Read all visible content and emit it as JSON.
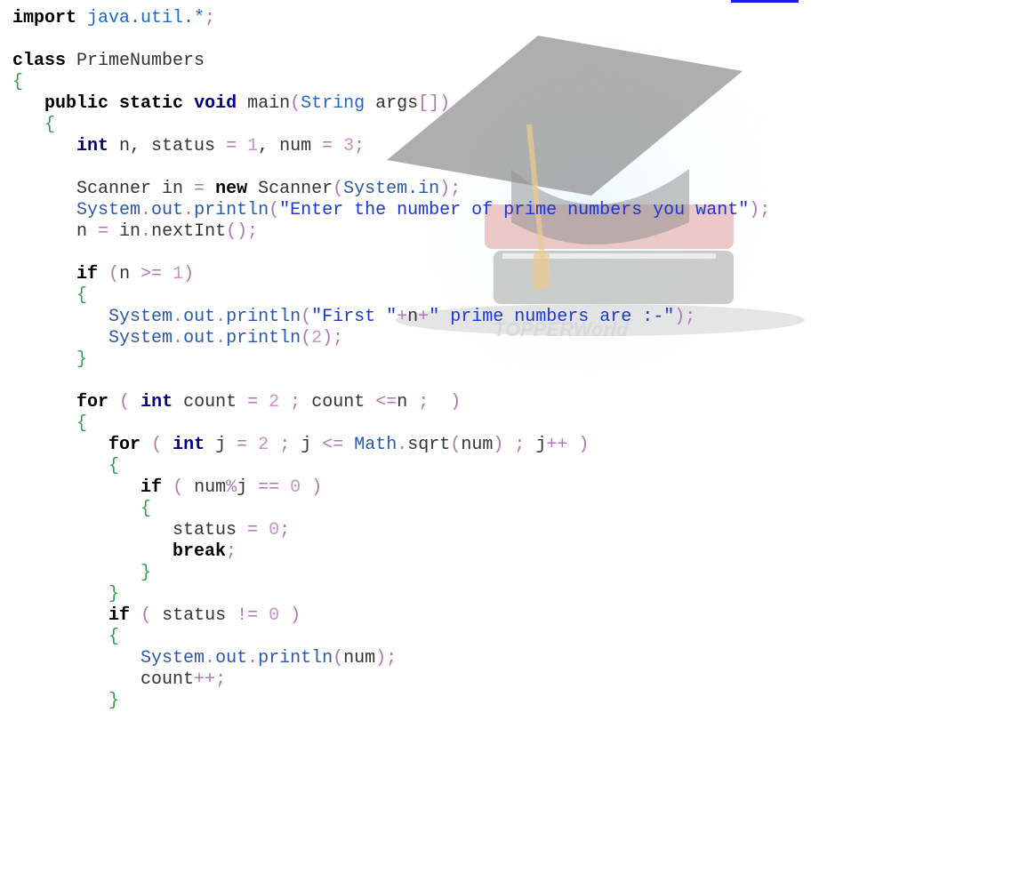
{
  "watermark": {
    "text": "TOPPERWorld"
  },
  "code": {
    "lines": [
      [
        {
          "t": "import",
          "c": "kb"
        },
        {
          "t": " java.util.*",
          "c": "pkg"
        },
        {
          "t": ";",
          "c": "sym"
        }
      ],
      [],
      [
        {
          "t": "class",
          "c": "kb"
        },
        {
          "t": " PrimeNumbers",
          "c": "plain"
        }
      ],
      [
        {
          "t": "{",
          "c": "brace"
        }
      ],
      [
        {
          "t": "   "
        },
        {
          "t": "public",
          "c": "kb"
        },
        {
          "t": " "
        },
        {
          "t": "static",
          "c": "kb"
        },
        {
          "t": " "
        },
        {
          "t": "void",
          "c": "kw"
        },
        {
          "t": " main",
          "c": "plain"
        },
        {
          "t": "(",
          "c": "sym"
        },
        {
          "t": "String",
          "c": "pkg"
        },
        {
          "t": " args",
          "c": "plain"
        },
        {
          "t": "[])",
          "c": "sym"
        }
      ],
      [
        {
          "t": "   "
        },
        {
          "t": "{",
          "c": "brace"
        }
      ],
      [
        {
          "t": "      "
        },
        {
          "t": "int",
          "c": "kw"
        },
        {
          "t": " n, status ",
          "c": "plain"
        },
        {
          "t": "=",
          "c": "sym"
        },
        {
          "t": " ",
          "c": "plain"
        },
        {
          "t": "1",
          "c": "num"
        },
        {
          "t": ", num ",
          "c": "plain"
        },
        {
          "t": "=",
          "c": "sym"
        },
        {
          "t": " ",
          "c": "plain"
        },
        {
          "t": "3",
          "c": "num"
        },
        {
          "t": ";",
          "c": "sym"
        }
      ],
      [],
      [
        {
          "t": "      Scanner in ",
          "c": "plain"
        },
        {
          "t": "=",
          "c": "sym"
        },
        {
          "t": " "
        },
        {
          "t": "new",
          "c": "kb"
        },
        {
          "t": " Scanner",
          "c": "plain"
        },
        {
          "t": "(",
          "c": "sym"
        },
        {
          "t": "System.in",
          "c": "sys"
        },
        {
          "t": ");",
          "c": "sym"
        }
      ],
      [
        {
          "t": "      "
        },
        {
          "t": "System",
          "c": "sys"
        },
        {
          "t": ".",
          "c": "sym"
        },
        {
          "t": "out",
          "c": "sys"
        },
        {
          "t": ".",
          "c": "sym"
        },
        {
          "t": "println",
          "c": "sys"
        },
        {
          "t": "(",
          "c": "sym"
        },
        {
          "t": "\"Enter the number of prime numbers you want\"",
          "c": "str"
        },
        {
          "t": ");",
          "c": "sym"
        }
      ],
      [
        {
          "t": "      n ",
          "c": "plain"
        },
        {
          "t": "=",
          "c": "sym"
        },
        {
          "t": " in",
          "c": "plain"
        },
        {
          "t": ".",
          "c": "sym"
        },
        {
          "t": "nextInt",
          "c": "plain"
        },
        {
          "t": "();",
          "c": "sym"
        }
      ],
      [],
      [
        {
          "t": "      "
        },
        {
          "t": "if",
          "c": "kb"
        },
        {
          "t": " ",
          "c": "plain"
        },
        {
          "t": "(",
          "c": "sym"
        },
        {
          "t": "n ",
          "c": "plain"
        },
        {
          "t": ">=",
          "c": "sym"
        },
        {
          "t": " ",
          "c": "plain"
        },
        {
          "t": "1",
          "c": "num"
        },
        {
          "t": ")",
          "c": "sym"
        }
      ],
      [
        {
          "t": "      "
        },
        {
          "t": "{",
          "c": "brace"
        }
      ],
      [
        {
          "t": "         "
        },
        {
          "t": "System",
          "c": "sys"
        },
        {
          "t": ".",
          "c": "sym"
        },
        {
          "t": "out",
          "c": "sys"
        },
        {
          "t": ".",
          "c": "sym"
        },
        {
          "t": "println",
          "c": "sys"
        },
        {
          "t": "(",
          "c": "sym"
        },
        {
          "t": "\"First \"",
          "c": "str"
        },
        {
          "t": "+",
          "c": "sym"
        },
        {
          "t": "n",
          "c": "plain"
        },
        {
          "t": "+",
          "c": "sym"
        },
        {
          "t": "\" prime numbers are :-\"",
          "c": "str"
        },
        {
          "t": ");",
          "c": "sym"
        }
      ],
      [
        {
          "t": "         "
        },
        {
          "t": "System",
          "c": "sys"
        },
        {
          "t": ".",
          "c": "sym"
        },
        {
          "t": "out",
          "c": "sys"
        },
        {
          "t": ".",
          "c": "sym"
        },
        {
          "t": "println",
          "c": "sys"
        },
        {
          "t": "(",
          "c": "sym"
        },
        {
          "t": "2",
          "c": "num"
        },
        {
          "t": ");",
          "c": "sym"
        }
      ],
      [
        {
          "t": "      "
        },
        {
          "t": "}",
          "c": "brace"
        }
      ],
      [],
      [
        {
          "t": "      "
        },
        {
          "t": "for",
          "c": "kb"
        },
        {
          "t": " ",
          "c": "plain"
        },
        {
          "t": "(",
          "c": "sym"
        },
        {
          "t": " "
        },
        {
          "t": "int",
          "c": "kw"
        },
        {
          "t": " count ",
          "c": "plain"
        },
        {
          "t": "=",
          "c": "sym"
        },
        {
          "t": " ",
          "c": "plain"
        },
        {
          "t": "2",
          "c": "num"
        },
        {
          "t": " ",
          "c": "plain"
        },
        {
          "t": ";",
          "c": "sym"
        },
        {
          "t": " count ",
          "c": "plain"
        },
        {
          "t": "<=",
          "c": "sym"
        },
        {
          "t": "n ",
          "c": "plain"
        },
        {
          "t": ";",
          "c": "sym"
        },
        {
          "t": "  ",
          "c": "plain"
        },
        {
          "t": ")",
          "c": "sym"
        }
      ],
      [
        {
          "t": "      "
        },
        {
          "t": "{",
          "c": "brace"
        }
      ],
      [
        {
          "t": "         "
        },
        {
          "t": "for",
          "c": "kb"
        },
        {
          "t": " ",
          "c": "plain"
        },
        {
          "t": "(",
          "c": "sym"
        },
        {
          "t": " "
        },
        {
          "t": "int",
          "c": "kw"
        },
        {
          "t": " j ",
          "c": "plain"
        },
        {
          "t": "=",
          "c": "sym"
        },
        {
          "t": " ",
          "c": "plain"
        },
        {
          "t": "2",
          "c": "num"
        },
        {
          "t": " ",
          "c": "plain"
        },
        {
          "t": ";",
          "c": "sym"
        },
        {
          "t": " j ",
          "c": "plain"
        },
        {
          "t": "<=",
          "c": "sym"
        },
        {
          "t": " ",
          "c": "plain"
        },
        {
          "t": "Math",
          "c": "sys"
        },
        {
          "t": ".",
          "c": "sym"
        },
        {
          "t": "sqrt",
          "c": "plain"
        },
        {
          "t": "(",
          "c": "sym"
        },
        {
          "t": "num",
          "c": "plain"
        },
        {
          "t": ")",
          "c": "sym"
        },
        {
          "t": " ",
          "c": "plain"
        },
        {
          "t": ";",
          "c": "sym"
        },
        {
          "t": " j",
          "c": "plain"
        },
        {
          "t": "++",
          "c": "sym"
        },
        {
          "t": " ",
          "c": "plain"
        },
        {
          "t": ")",
          "c": "sym"
        }
      ],
      [
        {
          "t": "         "
        },
        {
          "t": "{",
          "c": "brace"
        }
      ],
      [
        {
          "t": "            "
        },
        {
          "t": "if",
          "c": "kb"
        },
        {
          "t": " ",
          "c": "plain"
        },
        {
          "t": "(",
          "c": "sym"
        },
        {
          "t": " num",
          "c": "plain"
        },
        {
          "t": "%",
          "c": "sym"
        },
        {
          "t": "j ",
          "c": "plain"
        },
        {
          "t": "==",
          "c": "sym"
        },
        {
          "t": " ",
          "c": "plain"
        },
        {
          "t": "0",
          "c": "num"
        },
        {
          "t": " ",
          "c": "plain"
        },
        {
          "t": ")",
          "c": "sym"
        }
      ],
      [
        {
          "t": "            "
        },
        {
          "t": "{",
          "c": "brace"
        }
      ],
      [
        {
          "t": "               status ",
          "c": "plain"
        },
        {
          "t": "=",
          "c": "sym"
        },
        {
          "t": " ",
          "c": "plain"
        },
        {
          "t": "0",
          "c": "num"
        },
        {
          "t": ";",
          "c": "sym"
        }
      ],
      [
        {
          "t": "               "
        },
        {
          "t": "break",
          "c": "kb"
        },
        {
          "t": ";",
          "c": "sym"
        }
      ],
      [
        {
          "t": "            "
        },
        {
          "t": "}",
          "c": "brace"
        }
      ],
      [
        {
          "t": "         "
        },
        {
          "t": "}",
          "c": "brace"
        }
      ],
      [
        {
          "t": "         "
        },
        {
          "t": "if",
          "c": "kb"
        },
        {
          "t": " ",
          "c": "plain"
        },
        {
          "t": "(",
          "c": "sym"
        },
        {
          "t": " status ",
          "c": "plain"
        },
        {
          "t": "!=",
          "c": "sym"
        },
        {
          "t": " ",
          "c": "plain"
        },
        {
          "t": "0",
          "c": "num"
        },
        {
          "t": " ",
          "c": "plain"
        },
        {
          "t": ")",
          "c": "sym"
        }
      ],
      [
        {
          "t": "         "
        },
        {
          "t": "{",
          "c": "brace"
        }
      ],
      [
        {
          "t": "            "
        },
        {
          "t": "System",
          "c": "sys"
        },
        {
          "t": ".",
          "c": "sym"
        },
        {
          "t": "out",
          "c": "sys"
        },
        {
          "t": ".",
          "c": "sym"
        },
        {
          "t": "println",
          "c": "sys"
        },
        {
          "t": "(",
          "c": "sym"
        },
        {
          "t": "num",
          "c": "plain"
        },
        {
          "t": ");",
          "c": "sym"
        }
      ],
      [
        {
          "t": "            count",
          "c": "plain"
        },
        {
          "t": "++",
          "c": "sym"
        },
        {
          "t": ";",
          "c": "sym"
        }
      ],
      [
        {
          "t": "         "
        },
        {
          "t": "}",
          "c": "brace"
        }
      ]
    ]
  }
}
